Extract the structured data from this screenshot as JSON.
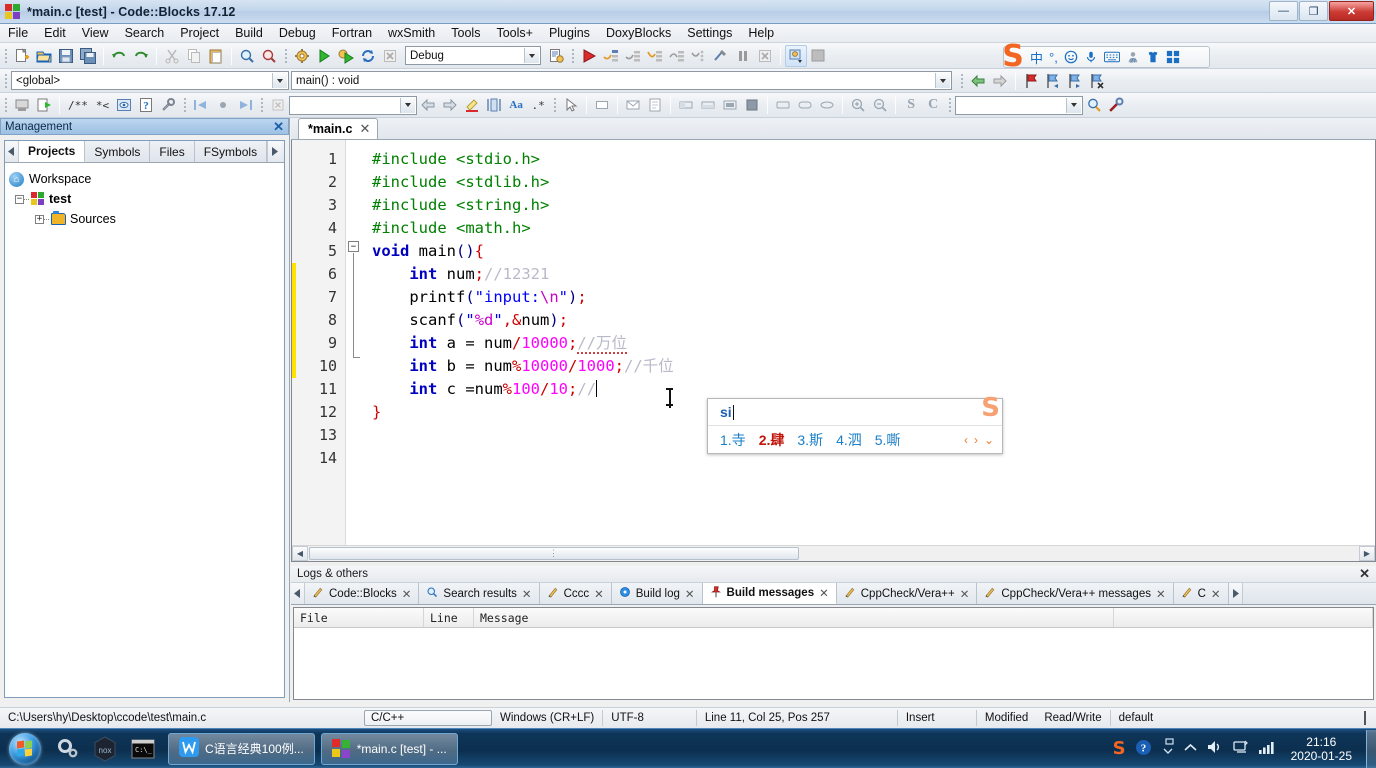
{
  "window": {
    "title": "*main.c [test] - Code::Blocks 17.12",
    "minimize": "—",
    "maximize": "❐",
    "close": "✕"
  },
  "menu": {
    "items": [
      "File",
      "Edit",
      "View",
      "Search",
      "Project",
      "Build",
      "Debug",
      "Fortran",
      "wxSmith",
      "Tools",
      "Tools+",
      "Plugins",
      "DoxyBlocks",
      "Settings",
      "Help"
    ]
  },
  "toolbar": {
    "build_target": "Debug",
    "scope": "<global>",
    "function": "main() : void",
    "goto_value": "",
    "search_value": ""
  },
  "sogou_bar": {
    "logo": "S",
    "items": [
      "中",
      "°,",
      "☺",
      "mic",
      "keyboard",
      "27",
      "skin",
      "apps"
    ]
  },
  "management": {
    "title": "Management",
    "close": "✕",
    "tabs": [
      "Projects",
      "Symbols",
      "Files",
      "FSymbols"
    ],
    "active_tab": "Projects",
    "tree": {
      "workspace": "Workspace",
      "project": "test",
      "sources": "Sources",
      "expander_minus": "−",
      "expander_plus": "+"
    }
  },
  "editor": {
    "tab_label": "*main.c",
    "tab_close": "✕",
    "line_numbers": [
      "1",
      "2",
      "3",
      "4",
      "5",
      "6",
      "7",
      "8",
      "9",
      "10",
      "11",
      "12",
      "13",
      "14"
    ],
    "lines": [
      {
        "n": "1",
        "tokens": [
          {
            "t": "#include ",
            "c": "pp"
          },
          {
            "t": "<stdio.h>",
            "c": "pp"
          }
        ]
      },
      {
        "n": "2",
        "tokens": [
          {
            "t": "#include ",
            "c": "pp"
          },
          {
            "t": "<stdlib.h>",
            "c": "pp"
          }
        ]
      },
      {
        "n": "3",
        "tokens": [
          {
            "t": "#include ",
            "c": "pp"
          },
          {
            "t": "<string.h>",
            "c": "pp"
          }
        ]
      },
      {
        "n": "4",
        "tokens": [
          {
            "t": "#include ",
            "c": "pp"
          },
          {
            "t": "<math.h>",
            "c": "pp"
          }
        ]
      },
      {
        "n": "5",
        "tokens": [
          {
            "t": "void",
            "c": "kw"
          },
          {
            "t": " main",
            "c": "id"
          },
          {
            "t": "()",
            "c": "pl"
          },
          {
            "t": "{",
            "c": "op"
          }
        ]
      },
      {
        "n": "6",
        "tokens": [
          {
            "t": "    ",
            "c": "id"
          },
          {
            "t": "int",
            "c": "kw"
          },
          {
            "t": " num",
            "c": "id"
          },
          {
            "t": ";",
            "c": "op"
          },
          {
            "t": "//12321",
            "c": "cmt"
          }
        ]
      },
      {
        "n": "7",
        "tokens": [
          {
            "t": "    printf",
            "c": "id"
          },
          {
            "t": "(",
            "c": "pl"
          },
          {
            "t": "\"input:",
            "c": "str"
          },
          {
            "t": "\\n",
            "c": "esc"
          },
          {
            "t": "\"",
            "c": "str"
          },
          {
            "t": ")",
            "c": "pl"
          },
          {
            "t": ";",
            "c": "op"
          }
        ]
      },
      {
        "n": "8",
        "tokens": [
          {
            "t": "    scanf",
            "c": "id"
          },
          {
            "t": "(",
            "c": "pl"
          },
          {
            "t": "\"",
            "c": "str"
          },
          {
            "t": "%d",
            "c": "esc"
          },
          {
            "t": "\"",
            "c": "str"
          },
          {
            "t": ",",
            "c": "op"
          },
          {
            "t": "&",
            "c": "op"
          },
          {
            "t": "num",
            "c": "id"
          },
          {
            "t": ")",
            "c": "pl"
          },
          {
            "t": ";",
            "c": "op"
          }
        ]
      },
      {
        "n": "9",
        "tokens": [
          {
            "t": "    ",
            "c": "id"
          },
          {
            "t": "int",
            "c": "kw"
          },
          {
            "t": " a = num",
            "c": "id"
          },
          {
            "t": "/",
            "c": "op"
          },
          {
            "t": "10000",
            "c": "num"
          },
          {
            "t": ";",
            "c": "op"
          },
          {
            "t": "//万位",
            "c": "cmt"
          }
        ]
      },
      {
        "n": "10",
        "tokens": [
          {
            "t": "    ",
            "c": "id"
          },
          {
            "t": "int",
            "c": "kw"
          },
          {
            "t": " b = num",
            "c": "id"
          },
          {
            "t": "%",
            "c": "op"
          },
          {
            "t": "10000",
            "c": "num"
          },
          {
            "t": "/",
            "c": "op"
          },
          {
            "t": "1000",
            "c": "num"
          },
          {
            "t": ";",
            "c": "op"
          },
          {
            "t": "//千位",
            "c": "cmt"
          }
        ]
      },
      {
        "n": "11",
        "tokens": [
          {
            "t": "    ",
            "c": "id"
          },
          {
            "t": "int",
            "c": "kw"
          },
          {
            "t": " c =num",
            "c": "id"
          },
          {
            "t": "%",
            "c": "op"
          },
          {
            "t": "100",
            "c": "num"
          },
          {
            "t": "/",
            "c": "op"
          },
          {
            "t": "10",
            "c": "num"
          },
          {
            "t": ";",
            "c": "op"
          },
          {
            "t": "//",
            "c": "cmt"
          }
        ]
      },
      {
        "n": "12",
        "tokens": [
          {
            "t": "}",
            "c": "op"
          }
        ]
      },
      {
        "n": "13",
        "tokens": []
      },
      {
        "n": "14",
        "tokens": []
      }
    ]
  },
  "ime": {
    "composition": "si",
    "candidates": [
      {
        "index": "1.",
        "word": "寺",
        "highlight": false
      },
      {
        "index": "2.",
        "word": "肆",
        "highlight": true
      },
      {
        "index": "3.",
        "word": "斯",
        "highlight": false
      },
      {
        "index": "4.",
        "word": "泗",
        "highlight": false
      },
      {
        "index": "5.",
        "word": "嘶",
        "highlight": false
      }
    ],
    "prev": "‹",
    "next": "›",
    "more": "⌄",
    "logo": "S"
  },
  "logs": {
    "title": "Logs & others",
    "close": "✕",
    "tabs": [
      {
        "label": "Code::Blocks",
        "icon": "pencil-icon",
        "active": false
      },
      {
        "label": "Search results",
        "icon": "magnifier-icon",
        "active": false
      },
      {
        "label": "Cccc",
        "icon": "pencil-icon",
        "active": false
      },
      {
        "label": "Build log",
        "icon": "gear-blue-icon",
        "active": false
      },
      {
        "label": "Build messages",
        "icon": "pin-icon",
        "active": true
      },
      {
        "label": "CppCheck/Vera++",
        "icon": "pencil-icon",
        "active": false
      },
      {
        "label": "CppCheck/Vera++ messages",
        "icon": "pencil-icon",
        "active": false
      },
      {
        "label": "C",
        "icon": "pencil-icon",
        "active": false
      }
    ],
    "columns": [
      "File",
      "Line",
      "Message"
    ],
    "rows": []
  },
  "statusbar": {
    "path": "C:\\Users\\hy\\Desktop\\ccode\\test\\main.c",
    "language": "C/C++",
    "eol": "Windows (CR+LF)",
    "encoding": "UTF-8",
    "position": "Line 11, Col 25, Pos 257",
    "insert_mode": "Insert",
    "modified": "Modified",
    "access": "Read/Write",
    "profile": "default"
  },
  "taskbar": {
    "buttons": [
      {
        "label": "C语言经典100例...",
        "icon": "wps-icon"
      },
      {
        "label": "*main.c [test] - ...",
        "icon": "codeblocks-icon"
      }
    ],
    "quick_launch": [
      "gear-icon",
      "nox-icon",
      "terminal-icon"
    ],
    "tray": [
      "sogou-icon",
      "help-icon",
      "show-hidden-icon",
      "volume-icon",
      "network-icon",
      "signal-icon"
    ],
    "clock_time": "21:16",
    "clock_date": "2020-01-25"
  },
  "colors": {
    "accent": "#1a6fc4",
    "sogou_orange": "#f26522",
    "keyword_blue": "#0000c0",
    "preproc_green": "#008000",
    "string_blue": "#0000ff",
    "number_magenta": "#ff00ff",
    "comment_gray": "#b9b9c9",
    "titlebar_blue": "#b8cde6"
  }
}
